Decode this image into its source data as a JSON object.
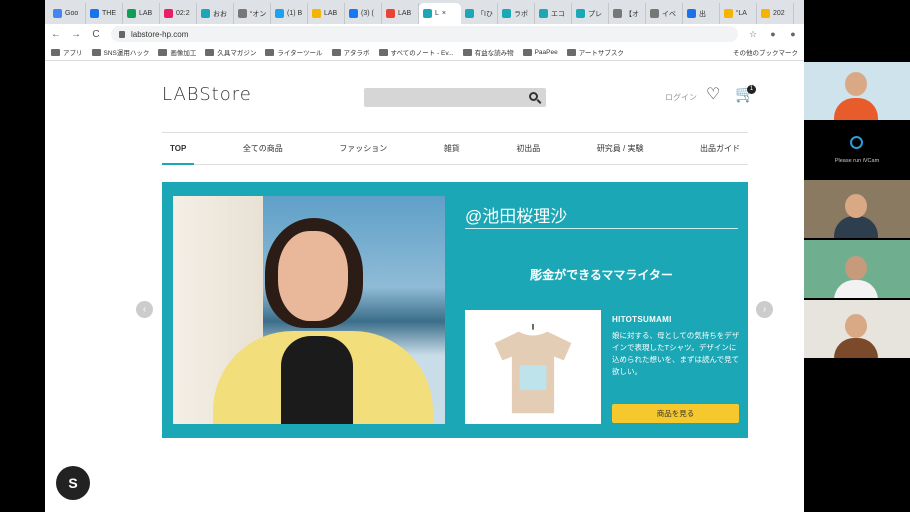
{
  "browser": {
    "tabs": [
      {
        "label": "Goo",
        "color": "#4285f4"
      },
      {
        "label": "THE",
        "color": "#1a73e8"
      },
      {
        "label": "LAB",
        "color": "#0f9d58"
      },
      {
        "label": "02:2",
        "color": "#e91e63"
      },
      {
        "label": "おお",
        "color": "#1ba7b5"
      },
      {
        "label": "“オン",
        "color": "#777777"
      },
      {
        "label": "(1) B",
        "color": "#1da1f2"
      },
      {
        "label": "LAB",
        "color": "#f4b400"
      },
      {
        "label": "(3) (",
        "color": "#1877f2"
      },
      {
        "label": "LAB",
        "color": "#ea4335"
      },
      {
        "label": "L",
        "color": "#1ba7b5",
        "active": true
      },
      {
        "label": "「Iひ",
        "color": "#1ba7b5"
      },
      {
        "label": "ラボ",
        "color": "#1ba7b5"
      },
      {
        "label": "エコ",
        "color": "#1ba7b5"
      },
      {
        "label": "プレ",
        "color": "#1ba7b5"
      },
      {
        "label": "【オ",
        "color": "#777777"
      },
      {
        "label": "イベ",
        "color": "#777777"
      },
      {
        "label": "出",
        "color": "#1a73e8"
      },
      {
        "label": "“LA",
        "color": "#f4b400"
      },
      {
        "label": "202",
        "color": "#f4b400"
      }
    ],
    "url": "labstore-hp.com",
    "bookmarks": [
      "アプリ",
      "SNS運用ハック",
      "画像加工",
      "久具マガジン",
      "ライターツール",
      "アタラボ",
      "すべてのノート - Ev...",
      "有益な読み物",
      "PaaPee",
      "アートサブスク"
    ],
    "other_bookmarks": "その他のブックマーク"
  },
  "header": {
    "logo": "LABStore",
    "login": "ログイン",
    "cart_count": "1"
  },
  "nav": [
    "TOP",
    "全ての商品",
    "ファッション",
    "雑貨",
    "初出品",
    "研究員 / 実験",
    "出品ガイド"
  ],
  "banner": {
    "handle": "@池田桜理沙",
    "tagline": "彫金ができるママライター",
    "product_name": "HITOTSUMAMI",
    "product_desc": "娘に対する、母としての気持ちをデザインで表現したTシャツ。デザインに込められた想いを、まずは読んで見て欲しい。",
    "buy_label": "商品を見る",
    "accent_color": "#1ba7b5",
    "button_color": "#f5c92e"
  },
  "video_call": {
    "ivcam_caption": "Please run iVCam"
  }
}
